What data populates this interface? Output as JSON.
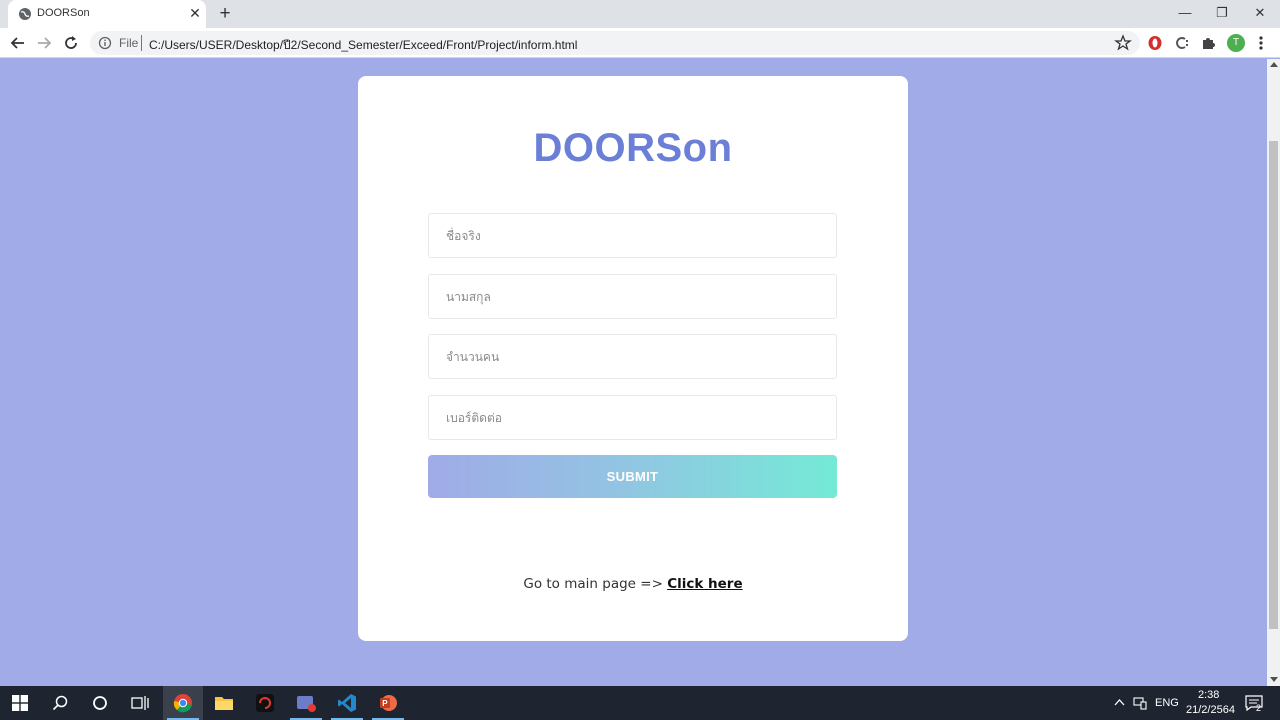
{
  "browser": {
    "tab_title": "DOORSon",
    "tab_close": "✕",
    "new_tab": "+",
    "scheme_label": "File",
    "url": "C:/Users/USER/Desktop/ปี2/Second_Semester/Exceed/Front/Project/inform.html",
    "profile_initial": "T",
    "window_controls": {
      "minimize": "—",
      "restore": "❐",
      "close": "✕"
    }
  },
  "page": {
    "brand": "DOORSon",
    "fields": [
      {
        "placeholder": "ชื่อจริง",
        "value": ""
      },
      {
        "placeholder": "นามสกุล",
        "value": ""
      },
      {
        "placeholder": "จำนวนคน",
        "value": ""
      },
      {
        "placeholder": "เบอร์ติดต่อ",
        "value": ""
      }
    ],
    "submit_label": "SUBMIT",
    "footer_prefix": "Go to main page => ",
    "footer_link": "Click here"
  },
  "colors": {
    "background": "#a0abe7",
    "brand": "#6b7fd7",
    "button_gradient_start": "#a0abe7",
    "button_gradient_end": "#74ead6"
  },
  "taskbar": {
    "apps": [
      "windows-start-icon",
      "search-icon",
      "cortana-icon",
      "task-view-icon",
      "chrome-icon",
      "file-explorer-icon",
      "game-app-icon",
      "screen-recorder-icon",
      "vscode-icon",
      "powerpoint-icon"
    ],
    "language": "ENG",
    "time": "2:38",
    "date": "21/2/2564",
    "notification_count": "2"
  }
}
